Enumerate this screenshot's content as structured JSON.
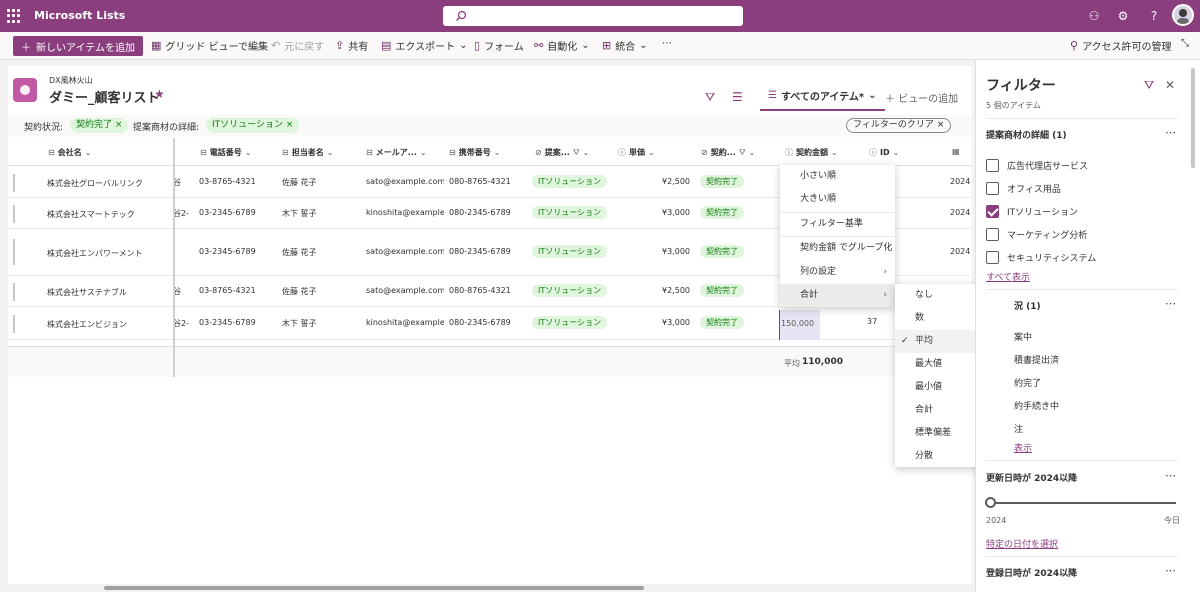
{
  "app": {
    "title": "Microsoft Lists"
  },
  "commandbar": {
    "new_item": "新しいアイテムを追加",
    "grid_edit": "グリッド ビューで編集",
    "undo": "元に戻す",
    "share": "共有",
    "export": "エクスポート",
    "forms": "フォーム",
    "automate": "自動化",
    "integrate": "統合",
    "more": "⋯",
    "manage_access": "アクセス許可の管理"
  },
  "list": {
    "site": "DX風林火山",
    "title": "ダミー_顧客リスト",
    "view_name": "すべてのアイテム*",
    "add_view": "ビューの追加"
  },
  "filters": {
    "status_label": "契約状況:",
    "status_value": "契約完了",
    "product_label": "提案商材の詳細:",
    "product_value": "ITソリューション",
    "clear": "フィルターのクリア"
  },
  "columns": {
    "company": "会社名",
    "phone": "電話番号",
    "person": "担当者名",
    "email": "メールア...",
    "mobile": "携帯番号",
    "proposal": "提案...",
    "unit_price": "単価",
    "contract": "契約...",
    "amount": "契約金額",
    "id": "ID"
  },
  "rows": [
    {
      "company": "株式会社グローバルリンク",
      "partial": "谷",
      "phone": "03-8765-4321",
      "person": "佐藤 花子",
      "email": "sato@example.com",
      "mobile": "080-8765-4321",
      "proposal": "ITソリューション",
      "price": "¥2,500",
      "status": "契約完了",
      "date": "2024"
    },
    {
      "company": "株式会社スマートテック",
      "partial": "谷2-",
      "phone": "03-2345-6789",
      "person": "木下 誓子",
      "email": "kinoshita@example...",
      "mobile": "080-2345-6789",
      "proposal": "ITソリューション",
      "price": "¥3,000",
      "status": "契約完了",
      "date": "2024"
    },
    {
      "company": "株式会社エンパワーメント",
      "partial": "",
      "phone": "03-2345-6789",
      "person": "佐藤 花子",
      "email": "sato@example.com",
      "mobile": "080-2345-6789",
      "proposal": "ITソリューション",
      "price": "¥3,000",
      "status": "契約完了",
      "date": "2024"
    },
    {
      "company": "株式会社サステナブル",
      "partial": "谷",
      "phone": "03-8765-4321",
      "person": "佐藤 花子",
      "email": "sato@example.com",
      "mobile": "080-8765-4321",
      "proposal": "ITソリューション",
      "price": "¥2,500",
      "status": "契約完了",
      "date": ""
    },
    {
      "company": "株式会社エンビジョン",
      "partial": "谷2-",
      "phone": "03-2345-6789",
      "person": "木下 誓子",
      "email": "kinoshita@example...",
      "mobile": "080-2345-6789",
      "proposal": "ITソリューション",
      "price": "¥3,000",
      "status": "契約完了",
      "date": ""
    }
  ],
  "last_row": {
    "amount": "150,000",
    "id": "37"
  },
  "footer": {
    "avg_label": "平均",
    "avg_value": "110,000"
  },
  "column_menu": {
    "items": [
      "小さい順",
      "大きい順",
      "フィルター基準",
      "契約金額 でグループ化",
      "列の設定",
      "合計"
    ]
  },
  "totals_menu": {
    "items": [
      "なし",
      "数",
      "平均",
      "最大値",
      "最小値",
      "合計",
      "標準偏差",
      "分散"
    ],
    "selected": "平均"
  },
  "filter_pane": {
    "title": "フィルター",
    "count": "5 個のアイテム",
    "section1_title": "提案商材の詳細 (1)",
    "section1_options": [
      {
        "label": "広告代理店サービス",
        "checked": false
      },
      {
        "label": "オフィス用品",
        "checked": false
      },
      {
        "label": "ITソリューション",
        "checked": true
      },
      {
        "label": "マーケティング分析",
        "checked": false
      },
      {
        "label": "セキュリティシステム",
        "checked": false
      }
    ],
    "show_all": "すべて表示",
    "section2_title": "況 (1)",
    "section2_options": [
      "案中",
      "積書提出済",
      "約完了",
      "約手続き中",
      "注"
    ],
    "show_all2": "表示",
    "section3_title": "更新日時が 2024以降",
    "slider_min": "2024",
    "slider_max": "今日",
    "date_link": "特定の日付を選択",
    "section4_title": "登録日時が 2024以降"
  }
}
